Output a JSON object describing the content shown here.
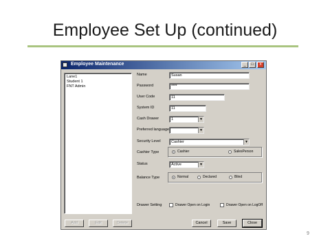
{
  "slide": {
    "title": "Employee Set Up (continued)",
    "page_number": "9"
  },
  "window": {
    "title": "Employee Maintenance",
    "buttons": [
      "_",
      "□",
      "x"
    ]
  },
  "employees": [
    "Lane1",
    "Student 1",
    "FNT Admin"
  ],
  "form": {
    "name": {
      "label": "Name",
      "value": "Susan"
    },
    "password": {
      "label": "Password",
      "value": "****"
    },
    "user_code": {
      "label": "User Code",
      "value": "11"
    },
    "system_id": {
      "label": "System ID",
      "value": "11"
    },
    "cash_drawer": {
      "label": "Cash Drawer",
      "value": "1"
    },
    "preferred_language": {
      "label": "Preferred language",
      "value": ""
    },
    "security_level": {
      "label": "Security Level",
      "value": "Cashier"
    },
    "cashier_type": {
      "label": "Cashier Type",
      "options": [
        "Cashier",
        "SalesPerson"
      ],
      "selected": "Cashier"
    },
    "status": {
      "label": "Status",
      "value": "Active"
    },
    "balance_type": {
      "label": "Balance Type",
      "options": [
        "Normal",
        "Declared",
        "Blind"
      ],
      "selected": "Normal"
    },
    "drawer_setting": {
      "label": "Drawer Setting",
      "options": [
        "Drawer Open on Login",
        "Drawer Open on LogOff"
      ]
    }
  },
  "left_buttons": [
    "Add",
    "Edit",
    "Delete"
  ],
  "right_buttons": [
    "Cancel",
    "Save",
    "Close"
  ]
}
